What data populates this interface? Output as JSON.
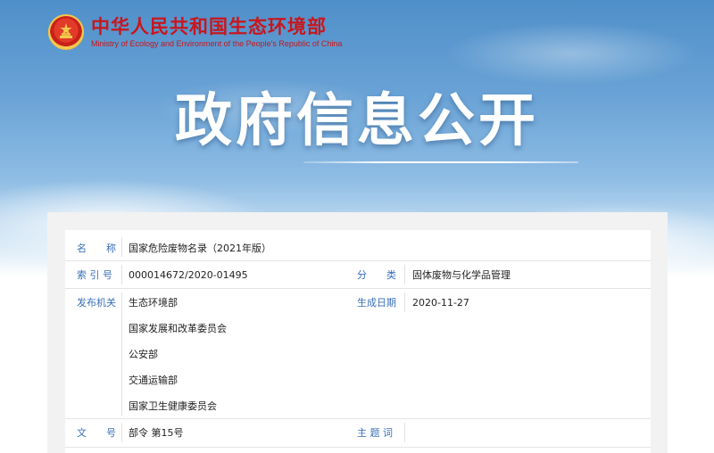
{
  "header": {
    "ministry_cn": "中华人民共和国生态环境部",
    "ministry_en": "Ministry of Ecology and Environment of the People's Republic of China",
    "emblem_icon": "national-emblem-icon",
    "brand_color": "#c8161d"
  },
  "banner": {
    "title": "政府信息公开"
  },
  "info": {
    "name_label": "名　　称",
    "name_value": "国家危险废物名录（2021年版）",
    "index_label": "索 引 号",
    "index_value": "000014672/2020-01495",
    "category_label": "分　　类",
    "category_value": "固体废物与化学品管理",
    "issuer_label": "发布机关",
    "issuers": [
      "生态环境部",
      "国家发展和改革委员会",
      "公安部",
      "交通运输部",
      "国家卫生健康委员会"
    ],
    "date_label": "生成日期",
    "date_value": "2020-11-27",
    "docno_label": "文　　号",
    "docno_value": "部令  第15号",
    "subject_label": "主 题 词",
    "subject_value": "",
    "label_color": "#3a6fb8"
  }
}
